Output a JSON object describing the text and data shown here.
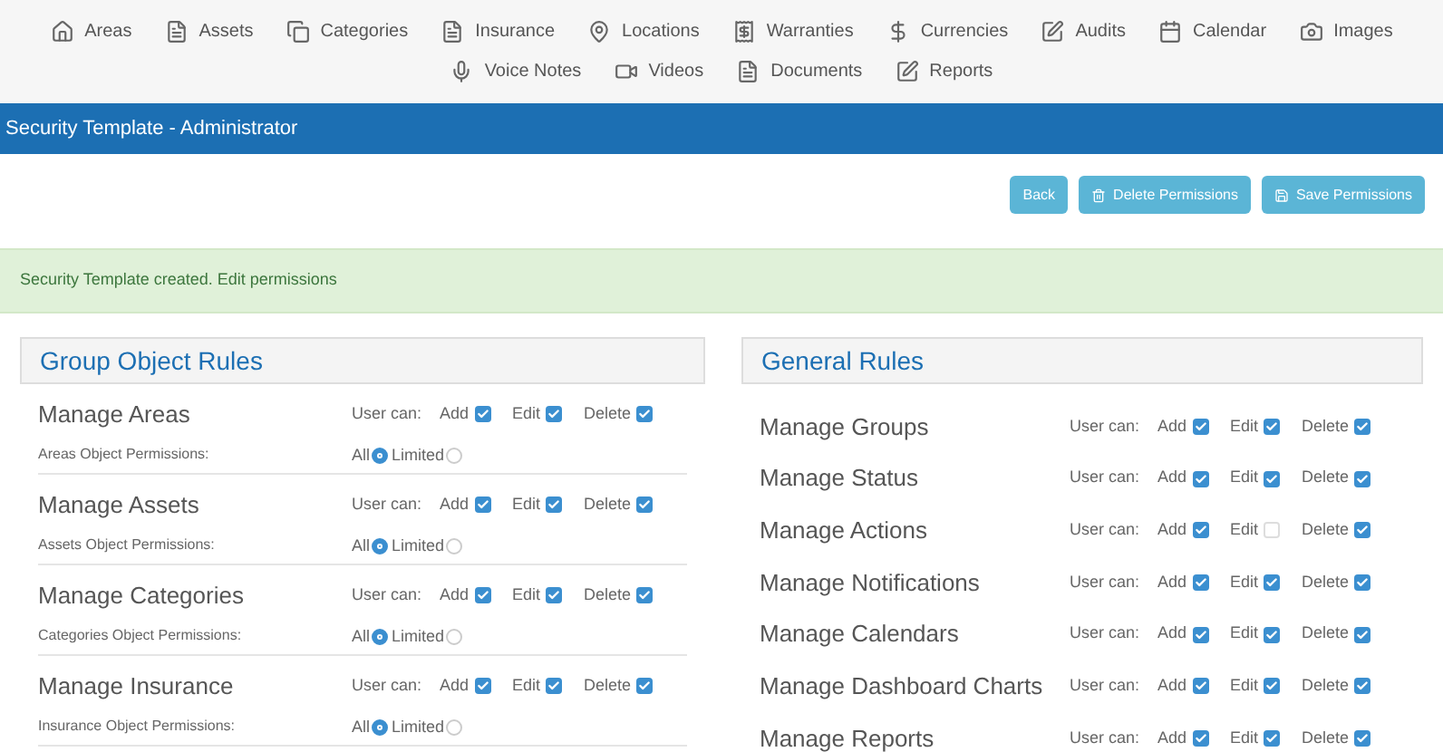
{
  "nav": [
    {
      "label": "Areas"
    },
    {
      "label": "Assets"
    },
    {
      "label": "Categories"
    },
    {
      "label": "Insurance"
    },
    {
      "label": "Locations"
    },
    {
      "label": "Warranties"
    },
    {
      "label": "Currencies"
    },
    {
      "label": "Audits"
    },
    {
      "label": "Calendar"
    },
    {
      "label": "Images"
    },
    {
      "label": "Voice Notes"
    },
    {
      "label": "Videos"
    },
    {
      "label": "Documents"
    },
    {
      "label": "Reports"
    }
  ],
  "title_bar": {
    "title": "Security Template - Administrator"
  },
  "actions": [
    {
      "label": "Back",
      "kind": "plain"
    },
    {
      "label": "Delete Permissions",
      "kind": "delete"
    },
    {
      "label": "Save Permissions",
      "kind": "save"
    }
  ],
  "alert": {
    "message": "Security Template created. Edit permissions"
  },
  "group_rules": {
    "heading": "Group Object Rules",
    "rows": [
      {
        "title": "Manage Areas",
        "user_can": "User can:",
        "perms": [
          {
            "label": "Add",
            "checked": true
          },
          {
            "label": "Edit",
            "checked": true
          },
          {
            "label": "Delete",
            "checked": true
          }
        ],
        "object_label": "Areas Object Permissions:",
        "options": [
          {
            "label": "All",
            "selected": true
          },
          {
            "label": "Limited",
            "selected": false
          }
        ]
      },
      {
        "title": "Manage Assets",
        "user_can": "User can:",
        "perms": [
          {
            "label": "Add",
            "checked": true
          },
          {
            "label": "Edit",
            "checked": true
          },
          {
            "label": "Delete",
            "checked": true
          }
        ],
        "object_label": "Assets Object Permissions:",
        "options": [
          {
            "label": "All",
            "selected": true
          },
          {
            "label": "Limited",
            "selected": false
          }
        ]
      },
      {
        "title": "Manage Categories",
        "user_can": "User can:",
        "perms": [
          {
            "label": "Add",
            "checked": true
          },
          {
            "label": "Edit",
            "checked": true
          },
          {
            "label": "Delete",
            "checked": true
          }
        ],
        "object_label": "Categories Object Permissions:",
        "options": [
          {
            "label": "All",
            "selected": true
          },
          {
            "label": "Limited",
            "selected": false
          }
        ]
      },
      {
        "title": "Manage Insurance",
        "user_can": "User can:",
        "perms": [
          {
            "label": "Add",
            "checked": true
          },
          {
            "label": "Edit",
            "checked": true
          },
          {
            "label": "Delete",
            "checked": true
          }
        ],
        "object_label": "Insurance Object Permissions:",
        "options": [
          {
            "label": "All",
            "selected": true
          },
          {
            "label": "Limited",
            "selected": false
          }
        ]
      }
    ]
  },
  "general_rules": {
    "heading": "General Rules",
    "rows": [
      {
        "title": "Manage Groups",
        "user_can": "User can:",
        "perms": [
          {
            "label": "Add",
            "checked": true
          },
          {
            "label": "Edit",
            "checked": true
          },
          {
            "label": "Delete",
            "checked": true
          }
        ]
      },
      {
        "title": "Manage Status",
        "user_can": "User can:",
        "perms": [
          {
            "label": "Add",
            "checked": true
          },
          {
            "label": "Edit",
            "checked": true
          },
          {
            "label": "Delete",
            "checked": true
          }
        ]
      },
      {
        "title": "Manage Actions",
        "user_can": "User can:",
        "perms": [
          {
            "label": "Add",
            "checked": true
          },
          {
            "label": "Edit",
            "checked": false
          },
          {
            "label": "Delete",
            "checked": true
          }
        ]
      },
      {
        "title": "Manage Notifications",
        "user_can": "User can:",
        "perms": [
          {
            "label": "Add",
            "checked": true
          },
          {
            "label": "Edit",
            "checked": true
          },
          {
            "label": "Delete",
            "checked": true
          }
        ]
      },
      {
        "title": "Manage Calendars",
        "user_can": "User can:",
        "perms": [
          {
            "label": "Add",
            "checked": true
          },
          {
            "label": "Edit",
            "checked": true
          },
          {
            "label": "Delete",
            "checked": true
          }
        ]
      },
      {
        "title": "Manage Dashboard Charts",
        "user_can": "User can:",
        "perms": [
          {
            "label": "Add",
            "checked": true
          },
          {
            "label": "Edit",
            "checked": true
          },
          {
            "label": "Delete",
            "checked": true
          }
        ]
      },
      {
        "title": "Manage Reports",
        "user_can": "User can:",
        "perms": [
          {
            "label": "Add",
            "checked": true
          },
          {
            "label": "Edit",
            "checked": true
          },
          {
            "label": "Delete",
            "checked": true
          }
        ]
      }
    ]
  }
}
